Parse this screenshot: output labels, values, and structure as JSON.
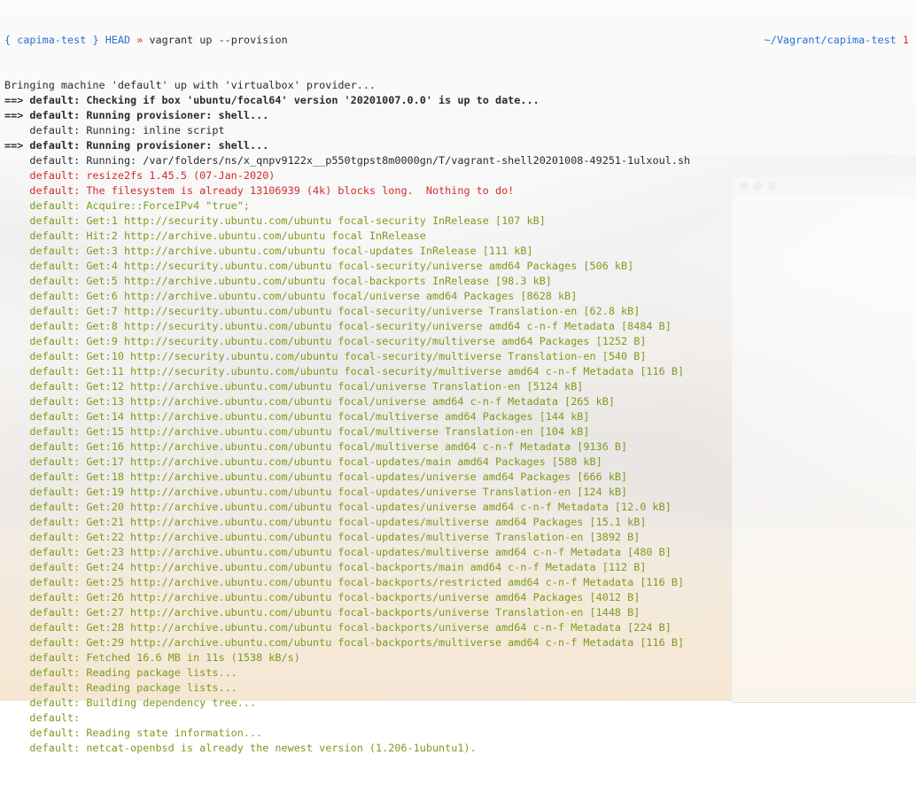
{
  "prompt": {
    "open_brace": "{ ",
    "project": "capima-test",
    "close_brace": " }",
    "branch": "HEAD",
    "arrow": "»",
    "command": "vagrant up --provision",
    "cwd": "~/Vagrant/capima-test",
    "exit_status": "1"
  },
  "colors": {
    "blue": "#2a6fd4",
    "red": "#d42a2a",
    "green": "#7b9c1e",
    "text": "#2b2b2b"
  },
  "output": [
    {
      "color": "dark",
      "text": "Bringing machine 'default' up with 'virtualbox' provider..."
    },
    {
      "color": "dark",
      "text": "==> default: Checking if box 'ubuntu/focal64' version '20201007.0.0' is up to date...",
      "bold": true
    },
    {
      "color": "dark",
      "text": "==> default: Running provisioner: shell...",
      "bold": true
    },
    {
      "color": "dark",
      "text": "    default: Running: inline script"
    },
    {
      "color": "dark",
      "text": "==> default: Running provisioner: shell...",
      "bold": true
    },
    {
      "color": "dark",
      "text": "    default: Running: /var/folders/ns/x_qnpv9122x__p550tgpst8m0000gn/T/vagrant-shell20201008-49251-1ulxoul.sh"
    },
    {
      "color": "red",
      "text": "    default: resize2fs 1.45.5 (07-Jan-2020)"
    },
    {
      "color": "red",
      "text": "    default: The filesystem is already 13106939 (4k) blocks long.  Nothing to do!"
    },
    {
      "color": "green",
      "text": "    default: Acquire::ForceIPv4 \"true\";"
    },
    {
      "color": "green",
      "text": "    default: Get:1 http://security.ubuntu.com/ubuntu focal-security InRelease [107 kB]"
    },
    {
      "color": "green",
      "text": "    default: Hit:2 http://archive.ubuntu.com/ubuntu focal InRelease"
    },
    {
      "color": "green",
      "text": "    default: Get:3 http://archive.ubuntu.com/ubuntu focal-updates InRelease [111 kB]"
    },
    {
      "color": "green",
      "text": "    default: Get:4 http://security.ubuntu.com/ubuntu focal-security/universe amd64 Packages [506 kB]"
    },
    {
      "color": "green",
      "text": "    default: Get:5 http://archive.ubuntu.com/ubuntu focal-backports InRelease [98.3 kB]"
    },
    {
      "color": "green",
      "text": "    default: Get:6 http://archive.ubuntu.com/ubuntu focal/universe amd64 Packages [8628 kB]"
    },
    {
      "color": "green",
      "text": "    default: Get:7 http://security.ubuntu.com/ubuntu focal-security/universe Translation-en [62.8 kB]"
    },
    {
      "color": "green",
      "text": "    default: Get:8 http://security.ubuntu.com/ubuntu focal-security/universe amd64 c-n-f Metadata [8484 B]"
    },
    {
      "color": "green",
      "text": "    default: Get:9 http://security.ubuntu.com/ubuntu focal-security/multiverse amd64 Packages [1252 B]"
    },
    {
      "color": "green",
      "text": "    default: Get:10 http://security.ubuntu.com/ubuntu focal-security/multiverse Translation-en [540 B]"
    },
    {
      "color": "green",
      "text": "    default: Get:11 http://security.ubuntu.com/ubuntu focal-security/multiverse amd64 c-n-f Metadata [116 B]"
    },
    {
      "color": "green",
      "text": "    default: Get:12 http://archive.ubuntu.com/ubuntu focal/universe Translation-en [5124 kB]"
    },
    {
      "color": "green",
      "text": "    default: Get:13 http://archive.ubuntu.com/ubuntu focal/universe amd64 c-n-f Metadata [265 kB]"
    },
    {
      "color": "green",
      "text": "    default: Get:14 http://archive.ubuntu.com/ubuntu focal/multiverse amd64 Packages [144 kB]"
    },
    {
      "color": "green",
      "text": "    default: Get:15 http://archive.ubuntu.com/ubuntu focal/multiverse Translation-en [104 kB]"
    },
    {
      "color": "green",
      "text": "    default: Get:16 http://archive.ubuntu.com/ubuntu focal/multiverse amd64 c-n-f Metadata [9136 B]"
    },
    {
      "color": "green",
      "text": "    default: Get:17 http://archive.ubuntu.com/ubuntu focal-updates/main amd64 Packages [588 kB]"
    },
    {
      "color": "green",
      "text": "    default: Get:18 http://archive.ubuntu.com/ubuntu focal-updates/universe amd64 Packages [666 kB]"
    },
    {
      "color": "green",
      "text": "    default: Get:19 http://archive.ubuntu.com/ubuntu focal-updates/universe Translation-en [124 kB]"
    },
    {
      "color": "green",
      "text": "    default: Get:20 http://archive.ubuntu.com/ubuntu focal-updates/universe amd64 c-n-f Metadata [12.0 kB]"
    },
    {
      "color": "green",
      "text": "    default: Get:21 http://archive.ubuntu.com/ubuntu focal-updates/multiverse amd64 Packages [15.1 kB]"
    },
    {
      "color": "green",
      "text": "    default: Get:22 http://archive.ubuntu.com/ubuntu focal-updates/multiverse Translation-en [3892 B]"
    },
    {
      "color": "green",
      "text": "    default: Get:23 http://archive.ubuntu.com/ubuntu focal-updates/multiverse amd64 c-n-f Metadata [480 B]"
    },
    {
      "color": "green",
      "text": "    default: Get:24 http://archive.ubuntu.com/ubuntu focal-backports/main amd64 c-n-f Metadata [112 B]"
    },
    {
      "color": "green",
      "text": "    default: Get:25 http://archive.ubuntu.com/ubuntu focal-backports/restricted amd64 c-n-f Metadata [116 B]"
    },
    {
      "color": "green",
      "text": "    default: Get:26 http://archive.ubuntu.com/ubuntu focal-backports/universe amd64 Packages [4012 B]"
    },
    {
      "color": "green",
      "text": "    default: Get:27 http://archive.ubuntu.com/ubuntu focal-backports/universe Translation-en [1448 B]"
    },
    {
      "color": "green",
      "text": "    default: Get:28 http://archive.ubuntu.com/ubuntu focal-backports/universe amd64 c-n-f Metadata [224 B]"
    },
    {
      "color": "green",
      "text": "    default: Get:29 http://archive.ubuntu.com/ubuntu focal-backports/multiverse amd64 c-n-f Metadata [116 B]"
    },
    {
      "color": "green",
      "text": "    default: Fetched 16.6 MB in 11s (1538 kB/s)"
    },
    {
      "color": "green",
      "text": "    default: Reading package lists..."
    },
    {
      "color": "green",
      "text": "    default: Reading package lists..."
    },
    {
      "color": "green",
      "text": "    default: Building dependency tree..."
    },
    {
      "color": "green",
      "text": "    default:"
    },
    {
      "color": "green",
      "text": "    default: Reading state information..."
    },
    {
      "color": "green",
      "text": "    default: netcat-openbsd is already the newest version (1.206-1ubuntu1)."
    }
  ]
}
